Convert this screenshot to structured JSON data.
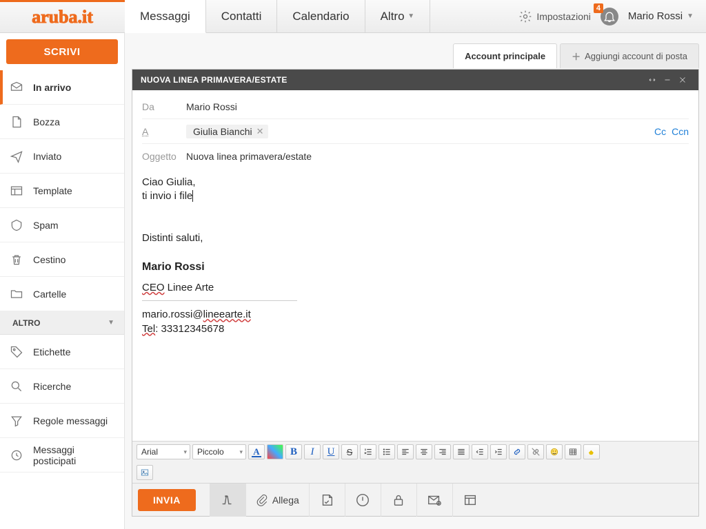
{
  "logo": "aruba.it",
  "nav_tabs": {
    "messaggi": "Messaggi",
    "contatti": "Contatti",
    "calendario": "Calendario",
    "altro": "Altro"
  },
  "top": {
    "settings": "Impostazioni",
    "notif_count": "4",
    "user": "Mario Rossi"
  },
  "compose_btn": "SCRIVI",
  "folders": {
    "inbox": "In arrivo",
    "draft": "Bozza",
    "sent": "Inviato",
    "template": "Template",
    "spam": "Spam",
    "trash": "Cestino",
    "cartelle": "Cartelle"
  },
  "sidebar_section": "ALTRO",
  "sidebar_other": {
    "etichette": "Etichette",
    "ricerche": "Ricerche",
    "regole": "Regole messaggi",
    "posticipati": "Messaggi posticipati"
  },
  "account_tabs": {
    "primary": "Account principale",
    "add": "Aggiungi account di posta"
  },
  "compose": {
    "title": "NUOVA LINEA PRIMAVERA/ESTATE",
    "from_label": "Da",
    "from": "Mario Rossi",
    "to_label": "A",
    "to_chip": "Giulia Bianchi",
    "cc": "Cc",
    "ccn": "Ccn",
    "subject_label": "Oggetto",
    "subject": "Nuova linea primavera/estate",
    "body_line1": "Ciao Giulia,",
    "body_line2a": "ti invio i ",
    "body_line2b": "file",
    "sig_greeting": "Distinti saluti,",
    "sig_name": "Mario Rossi",
    "sig_role_u": "CEO",
    "sig_role_rest": " Linee Arte",
    "sig_email_pre": "mario.rossi@",
    "sig_email_dom": "lineearte.it",
    "sig_tel_label": "Tel",
    "sig_tel": ": 33312345678"
  },
  "format": {
    "font": "Arial",
    "size": "Piccolo"
  },
  "actions": {
    "send": "INVIA",
    "attach": "Allega"
  }
}
